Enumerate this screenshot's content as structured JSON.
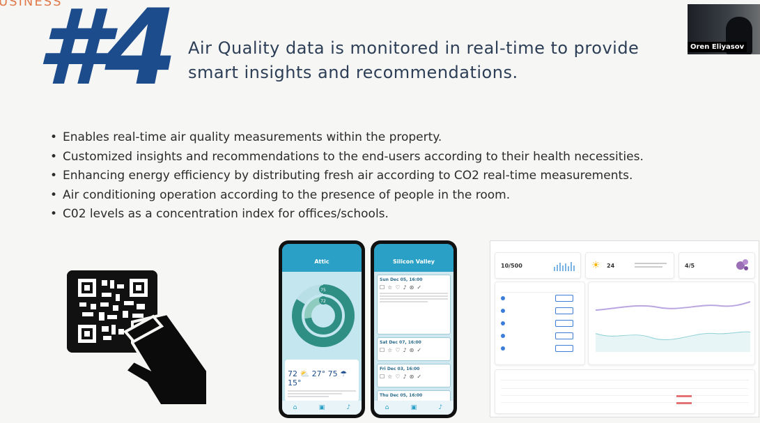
{
  "slide": {
    "corner_text": "USINESS",
    "number": "#4",
    "headline": "Air Quality data is monitored in real-time to provide smart insights and recommendations.",
    "bullets": [
      "Enables real-time air quality measurements within the property.",
      "Customized insights and recommendations to the end-users according to their health necessities.",
      "Enhancing energy efficiency by distributing fresh air according to CO2 real-time measurements.",
      "Air conditioning operation according to the presence of people in the room.",
      "C02 levels as a concentration index for offices/schools."
    ]
  },
  "video": {
    "participant_name": "Oren Eliyasov"
  },
  "phone1": {
    "title": "Attic",
    "ring_values": [
      "75",
      "72"
    ],
    "temps": "72 ⛅ 27°   75 ☂ 15°"
  },
  "phone2": {
    "title": "Silicon Valley",
    "entries": [
      {
        "date": "Sun Dec 05, 16:00"
      },
      {
        "date": "Sat Dec 07, 16:00"
      },
      {
        "date": "Fri Dec 03, 16:00"
      },
      {
        "date": "Thu Dec 05, 16:00"
      }
    ]
  },
  "dashboard": {
    "air_quality_value": "10/500",
    "weather_value": "24",
    "status_value": "4/5"
  },
  "colors": {
    "brand_blue": "#1d4c8d",
    "accent_orange": "#e07a4a",
    "app_teal": "#2aa0c7"
  }
}
